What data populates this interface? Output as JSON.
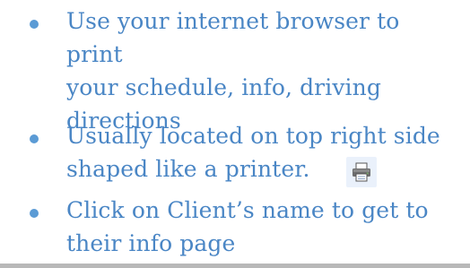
{
  "bullets": [
    {
      "text": "Use your internet browser to print\nyour schedule, info, driving\ndirections"
    },
    {
      "text": "Usually located on top right side\nshaped like a printer."
    },
    {
      "text": "Click on Client’s name to get to\ntheir info page"
    }
  ],
  "printer_icon": {
    "icon": "printer-icon"
  },
  "colors": {
    "text": "#4a86c5",
    "bullet": "#5b9bd5",
    "background": "#ffffff"
  }
}
